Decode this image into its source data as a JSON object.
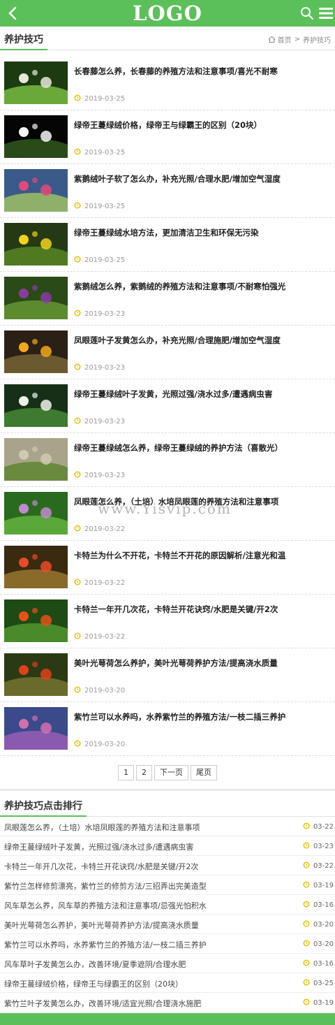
{
  "header": {
    "logo": "LOGO",
    "back_icon": "chevron-left-icon",
    "search_icon": "search-icon",
    "menu_icon": "menu-icon"
  },
  "colors": {
    "brand": "#5bc05a",
    "date_icon": "#e6c200"
  },
  "section": {
    "title": "养护技巧",
    "breadcrumb": {
      "home": "首页",
      "sep": ">",
      "current": "养护技巧"
    }
  },
  "articles": [
    {
      "title": "长春藤怎么养，长春藤的养殖方法和注意事项/喜光不耐寒",
      "date": "2019-03-25"
    },
    {
      "title": "绿帝王蔓绿绒价格，绿帝王与绿霸王的区别（20块）",
      "date": "2019-03-25"
    },
    {
      "title": "紫鹅绒叶子软了怎么办，补充光照/合理水肥/增加空气湿度",
      "date": "2019-03-25"
    },
    {
      "title": "绿帝王蔓绿绒水培方法，更加清洁卫生和环保无污染",
      "date": "2019-03-25"
    },
    {
      "title": "紫鹅绒怎么养，紫鹅绒的养殖方法和注意事项/不耐寒怕强光",
      "date": "2019-03-23"
    },
    {
      "title": "凤眼莲叶子发黄怎么办，补充光照/合理施肥/增加空气湿度",
      "date": "2019-03-23"
    },
    {
      "title": "绿帝王蔓绿绒叶子发黄，光照过强/浇水过多/遭遇病虫害",
      "date": "2019-03-23"
    },
    {
      "title": "绿帝王蔓绿绒怎么养，绿帝王蔓绿绒的养护方法（喜散光）",
      "date": "2019-03-23"
    },
    {
      "title": "凤眼莲怎么养，（土培）水培凤眼莲的养殖方法和注意事项",
      "date": "2019-03-22"
    },
    {
      "title": "卡特兰为什么不开花，卡特兰不开花的原因解析/注意光和温",
      "date": "2019-03-22"
    },
    {
      "title": "卡特兰一年开几次花，卡特兰开花诀窍/水肥是关键/开2次",
      "date": "2019-03-22"
    },
    {
      "title": "美叶光萼荷怎么养护，美叶光萼荷养护方法/提高浇水质量",
      "date": "2019-03-20"
    },
    {
      "title": "紫竹兰可以水养吗，水养紫竹兰的养殖方法/一枝二插三养护",
      "date": "2019-03-20"
    }
  ],
  "pagination": {
    "p1": "1",
    "p2": "2",
    "next": "下一页",
    "last": "尾页"
  },
  "ranking": {
    "title": "养护技巧点击排行",
    "items": [
      {
        "title": "凤眼莲怎么养，（土培）水培凤眼莲的养殖方法和注意事项",
        "date": "03-22"
      },
      {
        "title": "绿帝王蔓绿绒叶子发黄，光照过强/浇水过多/遭遇病虫害",
        "date": "03-23"
      },
      {
        "title": "卡特兰一年开几次花，卡特兰开花诀窍/水肥是关键/开2次",
        "date": "03-22"
      },
      {
        "title": "紫竹兰怎样修剪漂亮，紫竹兰的修剪方法/三招弄出完美造型",
        "date": "03-19"
      },
      {
        "title": "风车草怎么养，风车草的养殖方法和注意事项/忌强光怕积水",
        "date": "03-16"
      },
      {
        "title": "美叶光萼荷怎么养护，美叶光萼荷养护方法/提高浇水质量",
        "date": "03-20"
      },
      {
        "title": "紫竹兰可以水养吗，水养紫竹兰的养殖方法/一枝二插三养护",
        "date": "03-20"
      },
      {
        "title": "风车草叶子发黄怎么办，改善环境/夏季遮阴/合理水肥",
        "date": "03-16"
      },
      {
        "title": "绿帝王蔓绿绒价格，绿帝王与绿霸王的区别（20块）",
        "date": "03-25"
      },
      {
        "title": "紫竹兰叶子发黄怎么办，改善环境/适宜光照/合理浇水施肥",
        "date": "03-19"
      }
    ]
  },
  "watermark": "www.Yisvip.com"
}
